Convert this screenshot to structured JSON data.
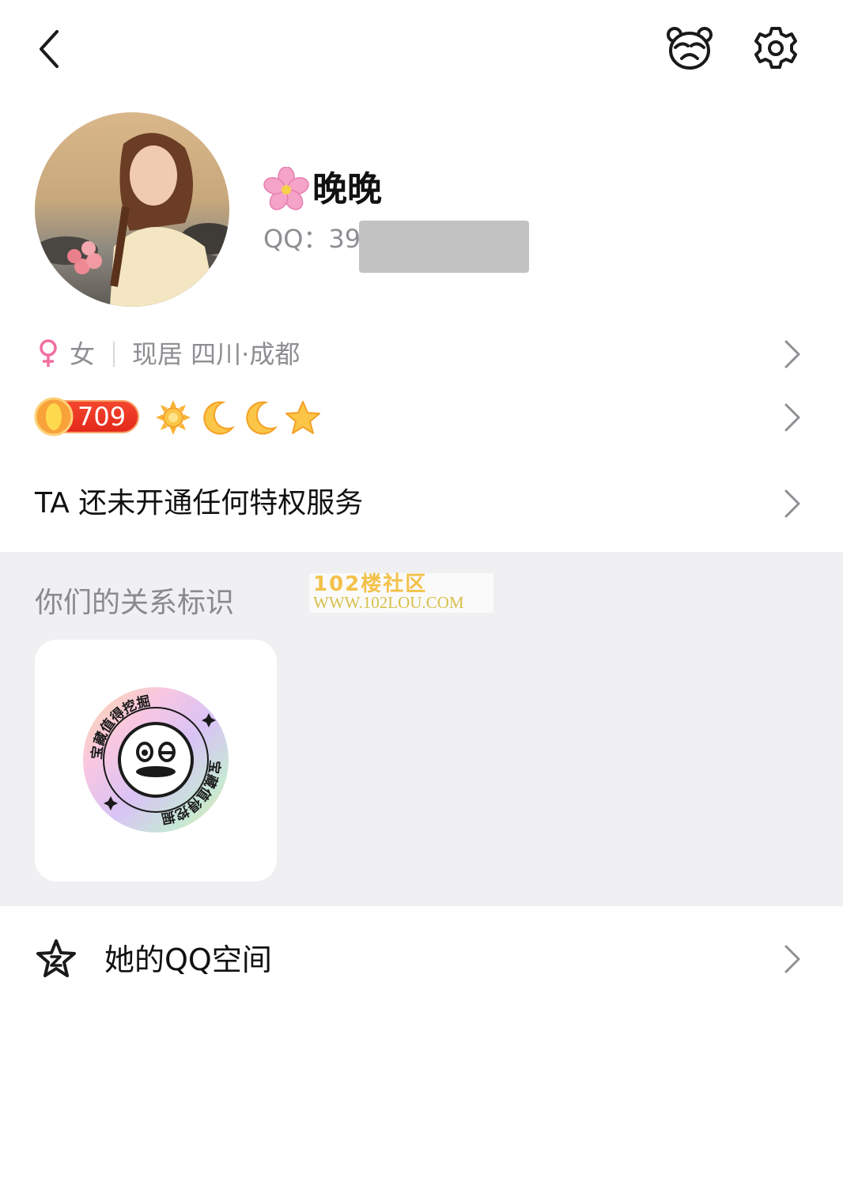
{
  "header": {
    "back_icon": "chevron-left-icon",
    "pet_icon": "bear-face-icon",
    "settings_icon": "gear-icon"
  },
  "profile": {
    "nickname": "晚晚",
    "nickname_emoji": "cherry-blossom-icon",
    "qq_label": "QQ：39",
    "avatar_description": "profile-photo"
  },
  "info": {
    "gender_symbol": "♀",
    "gender": "女",
    "residence": "现居 四川·成都",
    "gender_color": "#f26fa0"
  },
  "level": {
    "value": "709",
    "icons": [
      "sun-icon",
      "moon-icon",
      "moon-icon",
      "star-icon"
    ]
  },
  "privilege": {
    "text": "TA 还未开通任何特权服务"
  },
  "relation": {
    "title": "你们的关系标识",
    "badge_text": "宝藏值得挖掘",
    "watermark_line1": "102楼社区",
    "watermark_line2": "WWW.102LOU.COM"
  },
  "qzone": {
    "label": "她的QQ空间"
  },
  "colors": {
    "section_bg": "#f0f0f2",
    "secondary_text": "#8e8e93",
    "level_badge": "#e8321e"
  }
}
